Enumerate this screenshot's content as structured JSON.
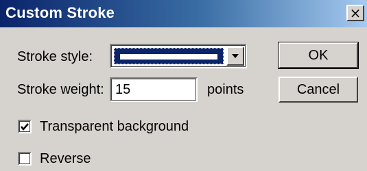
{
  "window": {
    "title": "Custom Stroke",
    "close_glyph": "×"
  },
  "stroke_style": {
    "label": "Stroke style:",
    "selected_icon": "solid-line-swatch",
    "selected_color": "#0a246a"
  },
  "stroke_weight": {
    "label": "Stroke weight:",
    "value": "15",
    "unit": "points"
  },
  "options": {
    "transparent_background": {
      "label": "Transparent background",
      "checked": true
    },
    "reverse": {
      "label": "Reverse",
      "checked": false
    }
  },
  "buttons": {
    "ok_label": "OK",
    "cancel_label": "Cancel"
  },
  "icons": {
    "close": "close-icon",
    "dropdown": "chevron-down-icon",
    "check": "checkmark-icon"
  },
  "colors": {
    "title_bar_start": "#0a246a",
    "title_bar_end": "#a6caf0",
    "dialog_background": "#d6d3ce"
  }
}
